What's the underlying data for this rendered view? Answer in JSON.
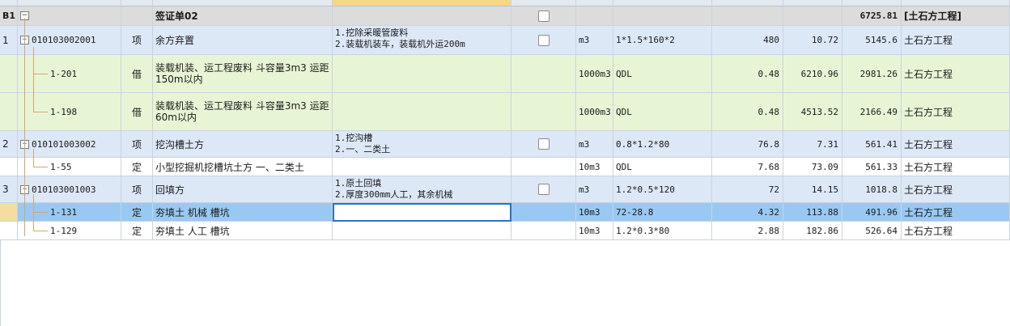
{
  "colors": {
    "group_row": "#dcdcdc",
    "item_row": "#dde8f7",
    "borrow_row": "#e8f5d5",
    "selected_row": "#99c9f2",
    "white_row": "#ffffff"
  },
  "group": {
    "code": "B1",
    "toggle": "−",
    "name": "签证单02",
    "total": "6725.81",
    "specialty": "[土石方工程]"
  },
  "rows": [
    {
      "seq": "1",
      "code": "010103002001",
      "type": "项",
      "name": "余方弃置",
      "desc1": "1.挖除采暖管废料",
      "desc2": "2.装载机装车，装载机外运200m",
      "unit": "m3",
      "expr": "1*1.5*160*2",
      "qty": "480",
      "price": "10.72",
      "total": "5145.6",
      "spec": "土石方工程"
    },
    {
      "seq": "",
      "code": "1-201",
      "type": "借",
      "name1": "装载机装、运工程废料 斗容量3m3 运距",
      "name2": "150m以内",
      "unit": "1000m3",
      "expr": "QDL",
      "qty": "0.48",
      "price": "6210.96",
      "total": "2981.26",
      "spec": "土石方工程"
    },
    {
      "seq": "",
      "code": "1-198",
      "type": "借",
      "name1": "装载机装、运工程废料 斗容量3m3 运距",
      "name2": "60m以内",
      "unit": "1000m3",
      "expr": "QDL",
      "qty": "0.48",
      "price": "4513.52",
      "total": "2166.49",
      "spec": "土石方工程"
    },
    {
      "seq": "2",
      "code": "010101003002",
      "type": "项",
      "name": "挖沟槽土方",
      "desc1": "1.挖沟槽",
      "desc2": "2.一、二类土",
      "unit": "m3",
      "expr": "0.8*1.2*80",
      "qty": "76.8",
      "price": "7.31",
      "total": "561.41",
      "spec": "土石方工程"
    },
    {
      "seq": "",
      "code": "1-55",
      "type": "定",
      "name": "小型挖掘机挖槽坑土方 一、二类土",
      "unit": "10m3",
      "expr": "QDL",
      "qty": "7.68",
      "price": "73.09",
      "total": "561.33",
      "spec": "土石方工程"
    },
    {
      "seq": "3",
      "code": "010103001003",
      "type": "项",
      "name": "回填方",
      "desc1": "1.原土回填",
      "desc2": "2.厚度300mm人工，其余机械",
      "unit": "m3",
      "expr": "1.2*0.5*120",
      "qty": "72",
      "price": "14.15",
      "total": "1018.8",
      "spec": "土石方工程"
    },
    {
      "seq": "",
      "code": "1-131",
      "type": "定",
      "name": "夯填土 机械 槽坑",
      "unit": "10m3",
      "expr": "72-28.8",
      "qty": "4.32",
      "price": "113.88",
      "total": "491.96",
      "spec": "土石方工程"
    },
    {
      "seq": "",
      "code": "1-129",
      "type": "定",
      "name": "夯填土 人工 槽坑",
      "unit": "10m3",
      "expr": "1.2*0.3*80",
      "qty": "2.88",
      "price": "182.86",
      "total": "526.64",
      "spec": "土石方工程"
    }
  ]
}
